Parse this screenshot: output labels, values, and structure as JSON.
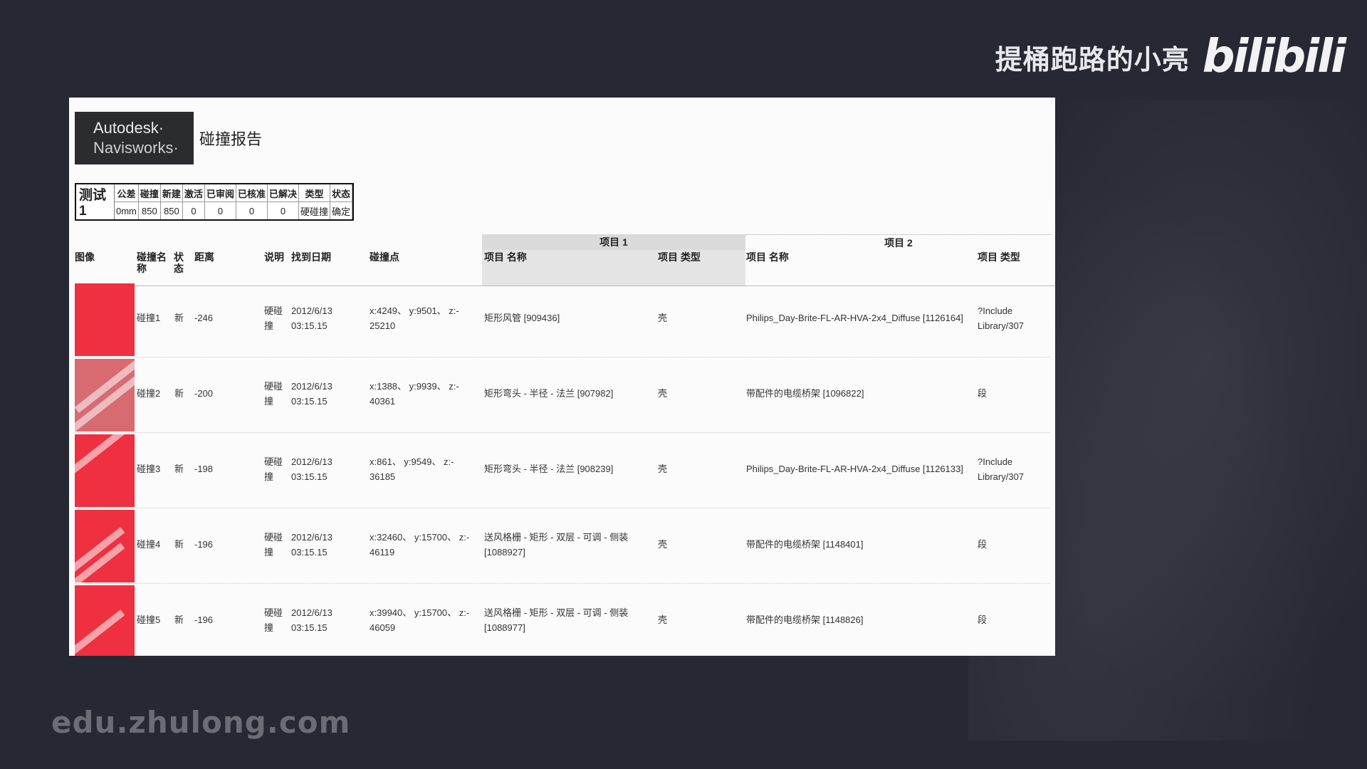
{
  "brand": {
    "name": "提桶跑路的小亮",
    "logo": "bilibili"
  },
  "watermark": "edu.zhulong.com",
  "report": {
    "logo_line1": "Autodesk·",
    "logo_line2": "Navisworks·",
    "title": "碰撞报告",
    "summary": {
      "test_name": "测试 1",
      "headers": [
        "公差",
        "碰撞",
        "新建",
        "激活",
        "已审阅",
        "已核准",
        "已解决",
        "类型",
        "状态"
      ],
      "values": [
        "0mm",
        "850",
        "850",
        "0",
        "0",
        "0",
        "0",
        "硬碰撞",
        "确定"
      ]
    },
    "group1": "项目 1",
    "group2": "项目 2",
    "columns": {
      "image": "图像",
      "clash_name": "碰撞名称",
      "status": "状态",
      "distance": "距离",
      "description": "说明",
      "found_date": "找到日期",
      "clash_point": "碰撞点",
      "item1_name": "项目 名称",
      "item1_type": "项目 类型",
      "item2_name": "项目 名称",
      "item2_type": "项目 类型"
    },
    "rows": [
      {
        "name": "碰撞1",
        "status": "新",
        "distance": "-246",
        "desc": "硬碰撞",
        "date": "2012/6/13",
        "time": "03:15.15",
        "point1": "x:4249、 y:9501、 z:-",
        "point2": "25210",
        "item1_name": "矩形风管 [909436]",
        "item1_type": "壳",
        "item2_name": "Philips_Day-Brite-FL-AR-HVA-2x4_Diffuse [1126164]",
        "item2_type1": "?Include",
        "item2_type2": "Library/307"
      },
      {
        "name": "碰撞2",
        "status": "新",
        "distance": "-200",
        "desc": "硬碰撞",
        "date": "2012/6/13",
        "time": "03:15.15",
        "point1": "x:1388、 y:9939、 z:-",
        "point2": "40361",
        "item1_name": "矩形弯头 - 半径 - 法兰 [907982]",
        "item1_type": "壳",
        "item2_name": "带配件的电缆桥架 [1096822]",
        "item2_type1": "段",
        "item2_type2": ""
      },
      {
        "name": "碰撞3",
        "status": "新",
        "distance": "-198",
        "desc": "硬碰撞",
        "date": "2012/6/13",
        "time": "03:15.15",
        "point1": "x:861、 y:9549、 z:-",
        "point2": "36185",
        "item1_name": "矩形弯头 - 半径 - 法兰 [908239]",
        "item1_type": "壳",
        "item2_name": "Philips_Day-Brite-FL-AR-HVA-2x4_Diffuse [1126133]",
        "item2_type1": "?Include",
        "item2_type2": "Library/307"
      },
      {
        "name": "碰撞4",
        "status": "新",
        "distance": "-196",
        "desc": "硬碰撞",
        "date": "2012/6/13",
        "time": "03:15.15",
        "point1": "x:32460、 y:15700、 z:-",
        "point2": "46119",
        "item1_name": "送风格栅 - 矩形 - 双层 - 可调 - 侧装",
        "item1_name2": "[1088927]",
        "item1_type": "壳",
        "item2_name": "带配件的电缆桥架 [1148401]",
        "item2_type1": "段",
        "item2_type2": ""
      },
      {
        "name": "碰撞5",
        "status": "新",
        "distance": "-196",
        "desc": "硬碰撞",
        "date": "2012/6/13",
        "time": "03:15.15",
        "point1": "x:39940、 y:15700、 z:-",
        "point2": "46059",
        "item1_name": "送风格栅 - 矩形 - 双层 - 可调 - 侧装",
        "item1_name2": "[1088977]",
        "item1_type": "壳",
        "item2_name": "带配件的电缆桥架 [1148826]",
        "item2_type1": "段",
        "item2_type2": ""
      }
    ]
  }
}
